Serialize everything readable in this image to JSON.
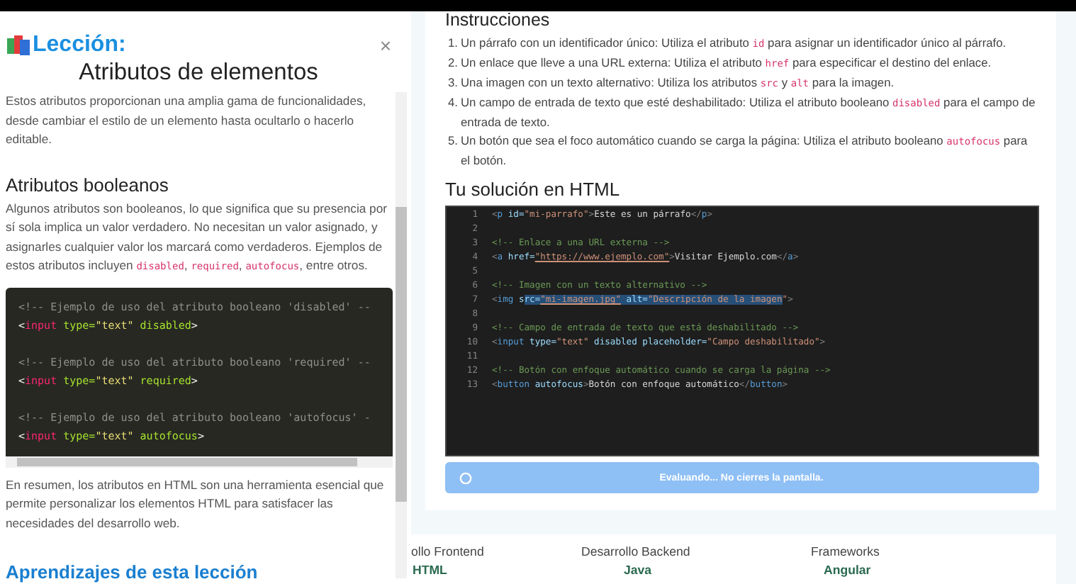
{
  "lesson": {
    "label": "Lección:",
    "title": "Atributos de elementos",
    "close": "×",
    "intro": "Estos atributos proporcionan una amplia gama de funcionalidades, desde cambiar el estilo de un elemento hasta ocultarlo o hacerlo editable.",
    "section_title": "Atributos booleanos",
    "section_text": [
      {
        "kind": "text",
        "text": "Algunos atributos son booleanos, lo que significa que su presencia por sí sola implica un valor verdadero. No necesitan un valor asignado, y asignarles cualquier valor los marcará como verdaderos. Ejemplos de estos atributos incluyen "
      },
      {
        "kind": "code",
        "text": "disabled"
      },
      {
        "kind": "text",
        "text": ", "
      },
      {
        "kind": "code",
        "text": "required"
      },
      {
        "kind": "text",
        "text": ", "
      },
      {
        "kind": "code",
        "text": "autofocus"
      },
      {
        "kind": "text",
        "text": ", entre otros."
      }
    ],
    "code": [
      {
        "kind": "code",
        "tokens": [
          {
            "kind": "comment",
            "text": "<!-- Ejemplo de uso del atributo booleano 'disabled' --"
          }
        ]
      },
      {
        "kind": "code",
        "tokens": [
          {
            "kind": "punct",
            "text": "<"
          },
          {
            "kind": "tag",
            "text": "input"
          },
          {
            "kind": "attr",
            "text": " type="
          },
          {
            "kind": "str",
            "text": "\"text\""
          },
          {
            "kind": "attr",
            "text": " disabled"
          },
          {
            "kind": "punct",
            "text": ">"
          }
        ]
      },
      {
        "kind": "blank"
      },
      {
        "kind": "code",
        "tokens": [
          {
            "kind": "comment",
            "text": "<!-- Ejemplo de uso del atributo booleano 'required' --"
          }
        ]
      },
      {
        "kind": "code",
        "tokens": [
          {
            "kind": "punct",
            "text": "<"
          },
          {
            "kind": "tag",
            "text": "input"
          },
          {
            "kind": "attr",
            "text": " type="
          },
          {
            "kind": "str",
            "text": "\"text\""
          },
          {
            "kind": "attr",
            "text": " required"
          },
          {
            "kind": "punct",
            "text": ">"
          }
        ]
      },
      {
        "kind": "blank"
      },
      {
        "kind": "code",
        "tokens": [
          {
            "kind": "comment",
            "text": "<!-- Ejemplo de uso del atributo booleano 'autofocus' -"
          }
        ]
      },
      {
        "kind": "code",
        "tokens": [
          {
            "kind": "punct",
            "text": "<"
          },
          {
            "kind": "tag",
            "text": "input"
          },
          {
            "kind": "attr",
            "text": " type="
          },
          {
            "kind": "str",
            "text": "\"text\""
          },
          {
            "kind": "attr",
            "text": " autofocus"
          },
          {
            "kind": "punct",
            "text": ">"
          }
        ]
      }
    ],
    "summary": "En resumen, los atributos en HTML son una herramienta esencial que permite personalizar los elementos HTML para satisfacer las necesidades del desarrollo web.",
    "learnings_title": "Aprendizajes de esta lección"
  },
  "exercise": {
    "instructions_title": "Instrucciones",
    "instructions": [
      {
        "number": "1.",
        "parts": [
          {
            "kind": "text",
            "text": "Un párrafo con un identificador único: Utiliza el atributo "
          },
          {
            "kind": "code",
            "text": "id"
          },
          {
            "kind": "text",
            "text": " para asignar un identificador único al párrafo."
          }
        ]
      },
      {
        "number": "2.",
        "parts": [
          {
            "kind": "text",
            "text": "Un enlace que lleve a una URL externa: Utiliza el atributo "
          },
          {
            "kind": "code",
            "text": "href"
          },
          {
            "kind": "text",
            "text": " para especificar el destino del enlace."
          }
        ]
      },
      {
        "number": "3.",
        "parts": [
          {
            "kind": "text",
            "text": "Una imagen con un texto alternativo: Utiliza los atributos "
          },
          {
            "kind": "code",
            "text": "src"
          },
          {
            "kind": "text",
            "text": " y "
          },
          {
            "kind": "code",
            "text": "alt"
          },
          {
            "kind": "text",
            "text": " para la imagen."
          }
        ]
      },
      {
        "number": "4.",
        "parts": [
          {
            "kind": "text",
            "text": "Un campo de entrada de texto que esté deshabilitado: Utiliza el atributo booleano "
          },
          {
            "kind": "code",
            "text": "disabled"
          },
          {
            "kind": "text",
            "text": " para el campo de entrada de texto."
          }
        ]
      },
      {
        "number": "5.",
        "parts": [
          {
            "kind": "text",
            "text": "Un botón que sea el foco automático cuando se carga la página: Utiliza el atributo booleano "
          },
          {
            "kind": "code",
            "text": "autofocus"
          },
          {
            "kind": "text",
            "text": " para el botón."
          }
        ]
      }
    ],
    "solution_title": "Tu solución en HTML",
    "editor": [
      {
        "number": "1",
        "tokens": [
          {
            "kind": "punct",
            "text": "<"
          },
          {
            "kind": "tag",
            "text": "p"
          },
          {
            "kind": "attr",
            "text": " id="
          },
          {
            "kind": "str",
            "text": "\"mi-parrafo\""
          },
          {
            "kind": "punct",
            "text": ">"
          },
          {
            "kind": "text",
            "text": "Este es un párrafo"
          },
          {
            "kind": "punct",
            "text": "</"
          },
          {
            "kind": "tag",
            "text": "p"
          },
          {
            "kind": "punct",
            "text": ">"
          }
        ]
      },
      {
        "number": "2"
      },
      {
        "number": "3",
        "tokens": [
          {
            "kind": "comment",
            "text": "<!-- Enlace a una URL externa -->"
          }
        ]
      },
      {
        "number": "4",
        "tokens": [
          {
            "kind": "punct",
            "text": "<"
          },
          {
            "kind": "tag",
            "text": "a"
          },
          {
            "kind": "attr",
            "text": " href="
          },
          {
            "kind": "link",
            "text": "\"https://www.ejemplo.com\""
          },
          {
            "kind": "punct",
            "text": ">"
          },
          {
            "kind": "text",
            "text": "Visitar Ejemplo.com"
          },
          {
            "kind": "punct",
            "text": "</"
          },
          {
            "kind": "tag",
            "text": "a"
          },
          {
            "kind": "punct",
            "text": ">"
          }
        ]
      },
      {
        "number": "5"
      },
      {
        "number": "6",
        "tokens": [
          {
            "kind": "comment",
            "text": "<!-- Imagen con un texto alternativo -->"
          }
        ]
      },
      {
        "number": "7",
        "tokens": [
          {
            "kind": "punct",
            "text": "<",
            "selected": false
          },
          {
            "kind": "tag",
            "text": "img",
            "selected": false
          },
          {
            "kind": "attr",
            "text": " s",
            "selected": false
          },
          {
            "kind": "attr",
            "text": "rc=",
            "selected": true
          },
          {
            "kind": "link",
            "text": "\"mi-imagen.jpg\"",
            "selected": true
          },
          {
            "kind": "attr",
            "text": " alt=",
            "selected": true
          },
          {
            "kind": "str",
            "text": "\"Descripción de la imagen",
            "selected": true
          },
          {
            "kind": "str",
            "text": "\"",
            "selected": false
          },
          {
            "kind": "punct",
            "text": ">",
            "selected": false
          }
        ]
      },
      {
        "number": "8"
      },
      {
        "number": "9",
        "tokens": [
          {
            "kind": "comment",
            "text": "<!-- Campo de entrada de texto que está deshabilitado -->"
          }
        ]
      },
      {
        "number": "10",
        "tokens": [
          {
            "kind": "punct",
            "text": "<"
          },
          {
            "kind": "tag",
            "text": "input"
          },
          {
            "kind": "attr",
            "text": " type="
          },
          {
            "kind": "str",
            "text": "\"text\""
          },
          {
            "kind": "attr",
            "text": " disabled placeholder="
          },
          {
            "kind": "str",
            "text": "\"Campo deshabilitado\""
          },
          {
            "kind": "punct",
            "text": ">"
          }
        ]
      },
      {
        "number": "11"
      },
      {
        "number": "12",
        "tokens": [
          {
            "kind": "comment",
            "text": "<!-- Botón con enfoque automático cuando se carga la página -->"
          }
        ]
      },
      {
        "number": "13",
        "tokens": [
          {
            "kind": "punct",
            "text": "<"
          },
          {
            "kind": "tag",
            "text": "button"
          },
          {
            "kind": "attr",
            "text": " autofocus"
          },
          {
            "kind": "punct",
            "text": ">"
          },
          {
            "kind": "text",
            "text": "Botón con enfoque automático"
          },
          {
            "kind": "punct",
            "text": "</"
          },
          {
            "kind": "tag",
            "text": "button"
          },
          {
            "kind": "punct",
            "text": ">"
          }
        ]
      }
    ],
    "evaluate_button": {
      "label": "Evaluando... No cierres la pantalla.",
      "loading": true
    }
  },
  "footer": [
    {
      "heading": "ollo Frontend",
      "link": "HTML"
    },
    {
      "heading": "Desarrollo Backend",
      "link": "Java"
    },
    {
      "heading": "Frameworks",
      "link": "Angular"
    }
  ]
}
